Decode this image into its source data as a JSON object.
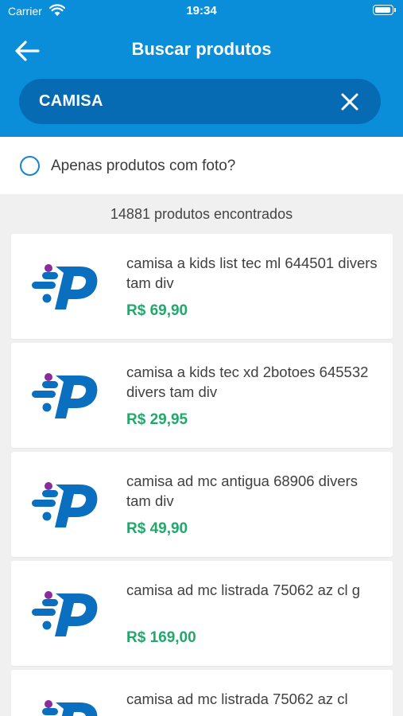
{
  "status": {
    "carrier": "Carrier",
    "time": "19:34"
  },
  "header": {
    "title": "Buscar produtos"
  },
  "search": {
    "value": "CAMISA"
  },
  "filter": {
    "label": "Apenas produtos com foto?",
    "checked": false
  },
  "results": {
    "count_text": "14881 produtos encontrados"
  },
  "colors": {
    "header": "#0a8ed9",
    "search_bg": "#076bb4",
    "price": "#23a86b",
    "logo_blue": "#0b6fc0",
    "logo_purple": "#8a2c9c"
  },
  "products": [
    {
      "name": "camisa  a kids list tec ml 644501 divers tam div",
      "price": "R$ 69,90",
      "icon": "store-logo-icon"
    },
    {
      "name": "camisa  a kids tec xd 2botoes 645532 divers tam div",
      "price": "R$ 29,95",
      "icon": "store-logo-icon"
    },
    {
      "name": "camisa  ad mc antigua 68906 divers tam div",
      "price": "R$ 49,90",
      "icon": "store-logo-icon"
    },
    {
      "name": "camisa  ad mc listrada 75062 az cl g",
      "price": "R$ 169,00",
      "icon": "store-logo-icon"
    },
    {
      "name": "camisa  ad mc listrada 75062 az cl",
      "price": "",
      "icon": "store-logo-icon"
    }
  ]
}
